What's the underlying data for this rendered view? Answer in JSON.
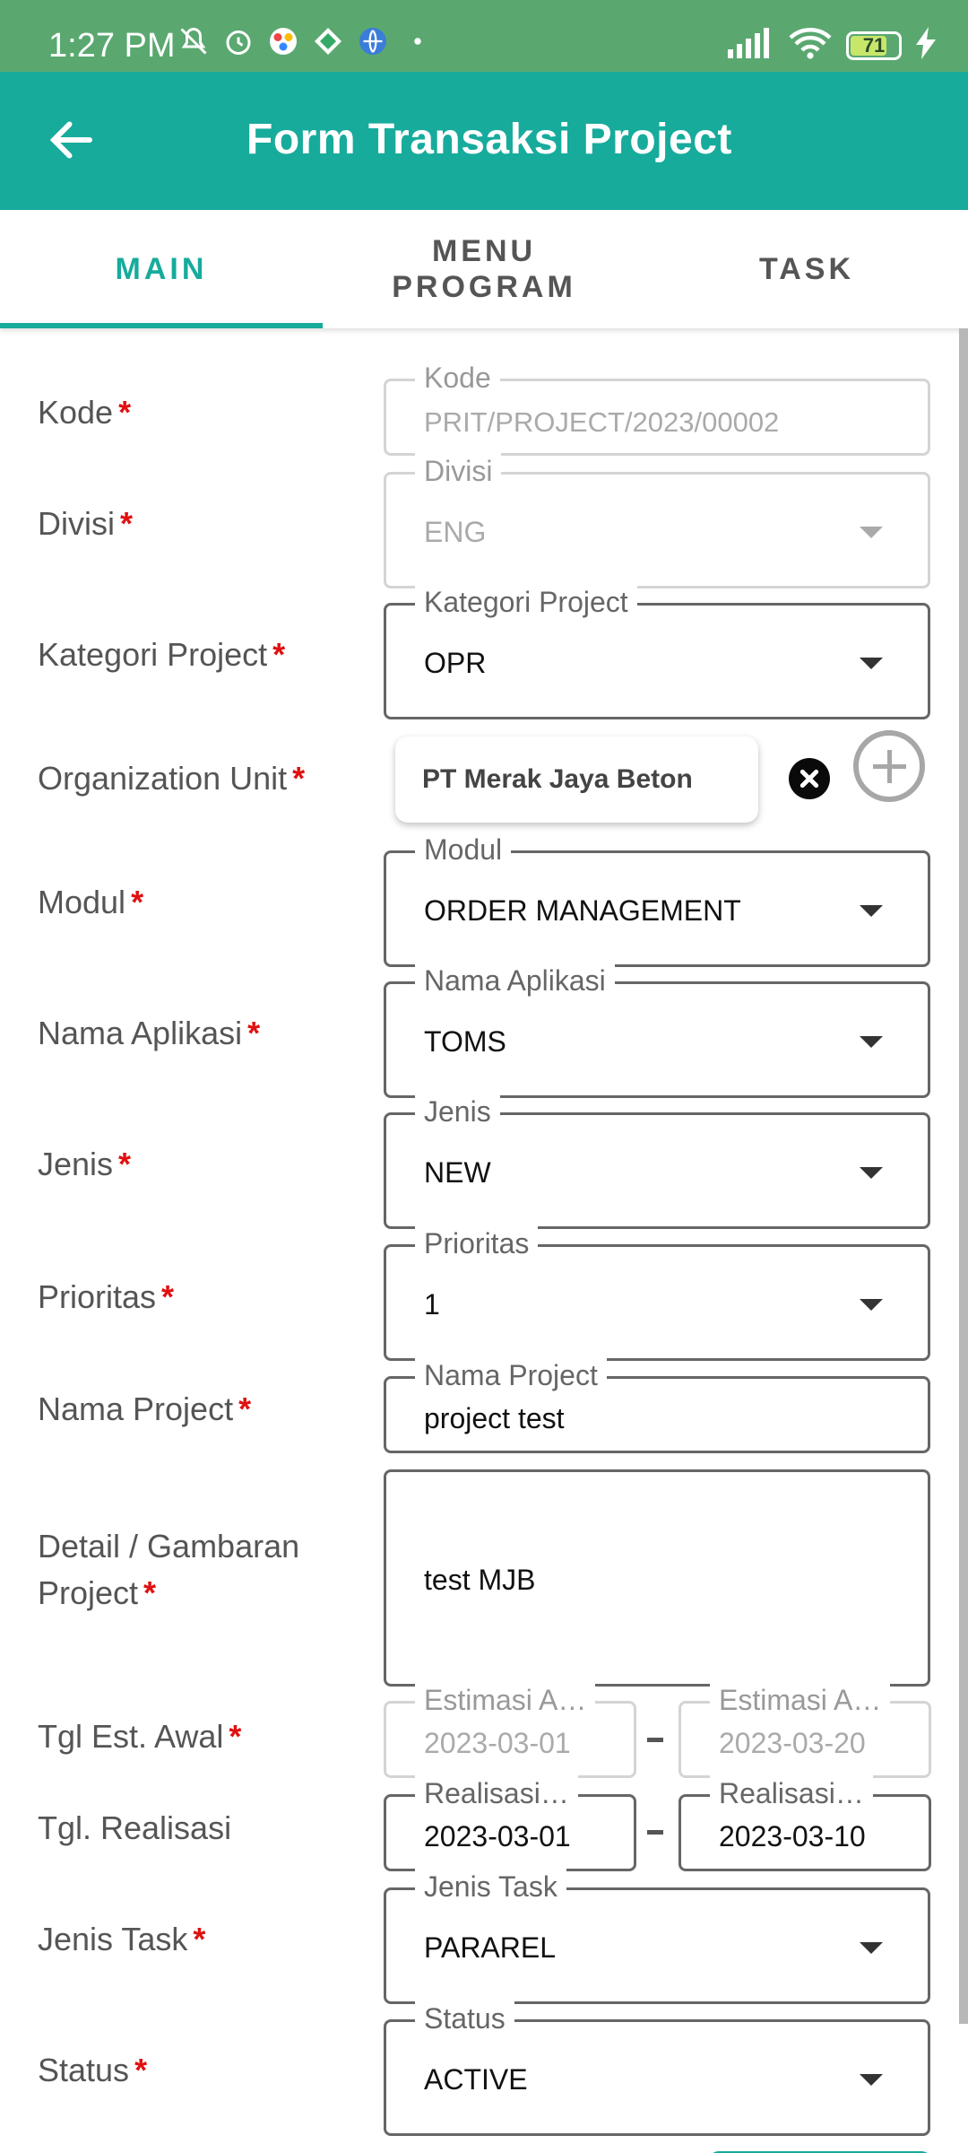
{
  "status_bar": {
    "time": "1:27 PM",
    "battery": "71"
  },
  "app_bar": {
    "title": "Form Transaksi Project"
  },
  "tabs": [
    {
      "label": "MAIN",
      "active": true
    },
    {
      "label": "MENU\nPROGRAM",
      "active": false
    },
    {
      "label": "TASK",
      "active": false
    }
  ],
  "form": {
    "kode": {
      "label": "Kode",
      "legend": "Kode",
      "value": "PRIT/PROJECT/2023/00002"
    },
    "divisi": {
      "label": "Divisi",
      "legend": "Divisi",
      "value": "ENG"
    },
    "kategori": {
      "label": "Kategori Project",
      "legend": "Kategori Project",
      "value": "OPR"
    },
    "org_unit": {
      "label": "Organization Unit",
      "chip": "PT Merak Jaya Beton"
    },
    "modul": {
      "label": "Modul",
      "legend": "Modul",
      "value": "ORDER MANAGEMENT"
    },
    "nama_aplikasi": {
      "label": "Nama Aplikasi",
      "legend": "Nama Aplikasi",
      "value": "TOMS"
    },
    "jenis": {
      "label": "Jenis",
      "legend": "Jenis",
      "value": "NEW"
    },
    "prioritas": {
      "label": "Prioritas",
      "legend": "Prioritas",
      "value": "1"
    },
    "nama_project": {
      "label": "Nama Project",
      "legend": "Nama Project",
      "value": "project test"
    },
    "detail": {
      "label_line1": "Detail / Gambaran",
      "label_line2": "Project",
      "value": "test MJB"
    },
    "tgl_est_awal": {
      "label": "Tgl Est. Awal",
      "legend_start": "Estimasi A…",
      "value_start": "2023-03-01",
      "legend_end": "Estimasi A…",
      "value_end": "2023-03-20"
    },
    "tgl_realisasi": {
      "label": "Tgl. Realisasi",
      "legend_start": "Realisasi…",
      "value_start": "2023-03-01",
      "legend_end": "Realisasi…",
      "value_end": "2023-03-10"
    },
    "jenis_task": {
      "label": "Jenis Task",
      "legend": "Jenis Task",
      "value": "PARAREL"
    },
    "status": {
      "label": "Status",
      "legend": "Status",
      "value": "ACTIVE"
    }
  },
  "required_marker": "*"
}
